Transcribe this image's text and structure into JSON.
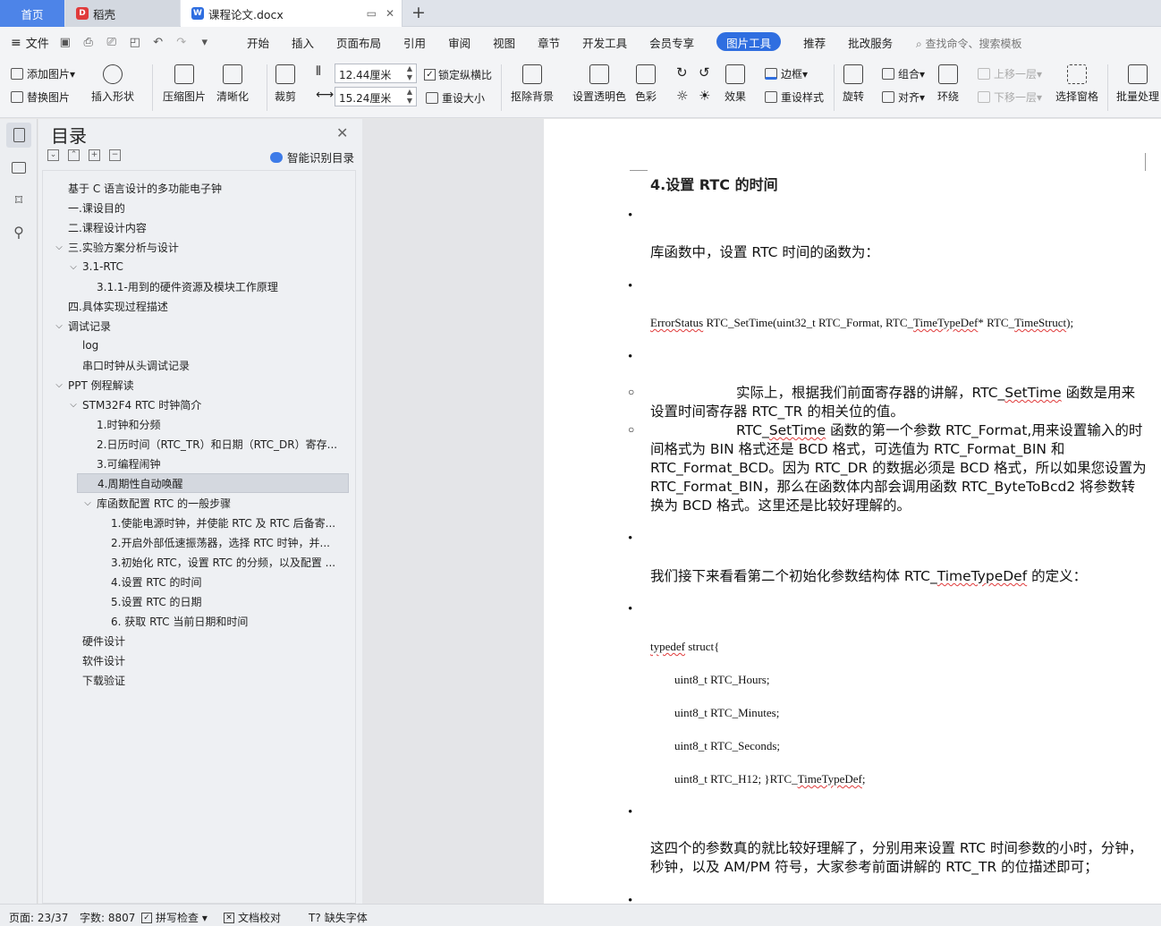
{
  "tabs": {
    "home": "首页",
    "daoke": "稻壳",
    "doc": "课程论文.docx"
  },
  "menu": {
    "file": "文件",
    "tabs": [
      "开始",
      "插入",
      "页面布局",
      "引用",
      "审阅",
      "视图",
      "章节",
      "开发工具",
      "会员专享",
      "图片工具",
      "推荐",
      "批改服务"
    ],
    "active_tab": "图片工具",
    "search": "查找命令、搜索模板"
  },
  "ribbon": {
    "add_picture": "添加图片",
    "replace_picture": "替换图片",
    "insert_shape": "插入形状",
    "compress": "压缩图片",
    "clarify": "清晰化",
    "crop": "裁剪",
    "height": "12.44厘米",
    "width": "15.24厘米",
    "lock_ratio": "锁定纵横比",
    "reset_size": "重设大小",
    "remove_bg": "抠除背景",
    "set_transparent": "设置透明色",
    "color": "色彩",
    "effects": "效果",
    "border": "边框",
    "reset_style": "重设样式",
    "rotate": "旋转",
    "group": "组合",
    "align": "对齐",
    "wrap": "环绕",
    "bring_forward": "上移一层",
    "send_backward": "下移一层",
    "select_pane": "选择窗格",
    "batch": "批量处理"
  },
  "toc": {
    "title": "目录",
    "ai_label": "智能识别目录",
    "items": [
      {
        "text": "基于 C 语言设计的多功能电子钟",
        "level": 0,
        "arrow": ""
      },
      {
        "text": "一.课设目的",
        "level": 0,
        "arrow": ""
      },
      {
        "text": "二.课程设计内容",
        "level": 0,
        "arrow": ""
      },
      {
        "text": "三.实验方案分析与设计",
        "level": 0,
        "arrow": "v"
      },
      {
        "text": "3.1-RTC",
        "level": 1,
        "arrow": "v"
      },
      {
        "text": "3.1.1-用到的硬件资源及模块工作原理",
        "level": 2,
        "arrow": ""
      },
      {
        "text": "四.具体实现过程描述",
        "level": 0,
        "arrow": ""
      },
      {
        "text": "调试记录",
        "level": 0,
        "arrow": "v"
      },
      {
        "text": "log",
        "level": 1,
        "arrow": ""
      },
      {
        "text": "串口时钟从头调试记录",
        "level": 1,
        "arrow": ""
      },
      {
        "text": "PPT 例程解读",
        "level": 0,
        "arrow": "v"
      },
      {
        "text": "STM32F4 RTC 时钟简介",
        "level": 1,
        "arrow": "v"
      },
      {
        "text": "1.时钟和分频",
        "level": 2,
        "arrow": ""
      },
      {
        "text": "2.日历时间（RTC_TR）和日期（RTC_DR）寄存...",
        "level": 2,
        "arrow": ""
      },
      {
        "text": "3.可编程闹钟",
        "level": 2,
        "arrow": ""
      },
      {
        "text": "4.周期性自动唤醒",
        "level": 2,
        "arrow": "",
        "selected": true
      },
      {
        "text": "库函数配置 RTC 的一般步骤",
        "level": 2,
        "arrow": "v"
      },
      {
        "text": "1.使能电源时钟，并使能 RTC 及 RTC 后备寄...",
        "level": 3,
        "arrow": ""
      },
      {
        "text": "2.开启外部低速振荡器，选择 RTC 时钟，并...",
        "level": 3,
        "arrow": ""
      },
      {
        "text": "3.初始化 RTC，设置 RTC 的分频，以及配置 ...",
        "level": 3,
        "arrow": ""
      },
      {
        "text": "4.设置 RTC 的时间",
        "level": 3,
        "arrow": ""
      },
      {
        "text": "5.设置 RTC 的日期",
        "level": 3,
        "arrow": ""
      },
      {
        "text": "6. 获取 RTC 当前日期和时间",
        "level": 3,
        "arrow": ""
      },
      {
        "text": "硬件设计",
        "level": 1,
        "arrow": ""
      },
      {
        "text": "软件设计",
        "level": 1,
        "arrow": ""
      },
      {
        "text": "下载验证",
        "level": 1,
        "arrow": ""
      }
    ]
  },
  "document": {
    "heading": "4.设置 RTC 的时间",
    "p1": "库函数中，设置 RTC 时间的函数为：",
    "code1_pre": "ErrorStatus",
    "code1_mid": " RTC_SetTime(uint32_t RTC_Format, RTC_",
    "code1_w2": "TimeTypeDef",
    "code1_mid2": "* RTC_",
    "code1_w3": "TimeStruct",
    "code1_end": ");",
    "p2a_indent": "实际上，根据我们前面寄存器的讲解，RTC_",
    "p2a_w": "SetTime",
    "p2a_rest": " 函数是用来设置时间寄存器 RTC_TR 的相关位的值。",
    "p2b_pre": "RTC_",
    "p2b_w": "SetTime",
    "p2b_rest": " 函数的第一个参数 RTC_Format,用来设置输入的时间格式为 BIN 格式还是 BCD 格式，可选值为 RTC_Format_BIN 和 RTC_Format_BCD。因为 RTC_DR 的数据必须是 BCD 格式，所以如果您设置为 RTC_Format_BIN，那么在函数体内部会调用函数 RTC_ByteToBcd2 将参数转换为 BCD 格式。这里还是比较好理解的。",
    "p3_pre": "我们接下来看看第二个初始化参数结构体 RTC_",
    "p3_w": "TimeTypeDef",
    "p3_end": " 的定义：",
    "code2_w": "typedef",
    "code2_rest": " struct{",
    "code3": "uint8_t RTC_Hours;",
    "code4": "uint8_t RTC_Minutes;",
    "code5": "uint8_t RTC_Seconds;",
    "code6_pre": "uint8_t RTC_H12; }RTC_",
    "code6_w": "TimeTypeDef",
    "code6_end": ";",
    "p4": "这四个的参数真的就比较好理解了，分别用来设置 RTC 时间参数的小时，分钟，秒钟，以及 AM/PM 符号，大家参考前面讲解的 RTC_TR 的位描述即可；"
  },
  "status": {
    "page": "页面: 23/37",
    "words": "字数: 8807",
    "spell": "拼写检查",
    "proof": "文档校对",
    "missing_font": "缺失字体"
  },
  "colors": {
    "accent": "#2f6ee0",
    "home_tab": "#4d84e8",
    "spell_underline": "#e03b3b"
  }
}
